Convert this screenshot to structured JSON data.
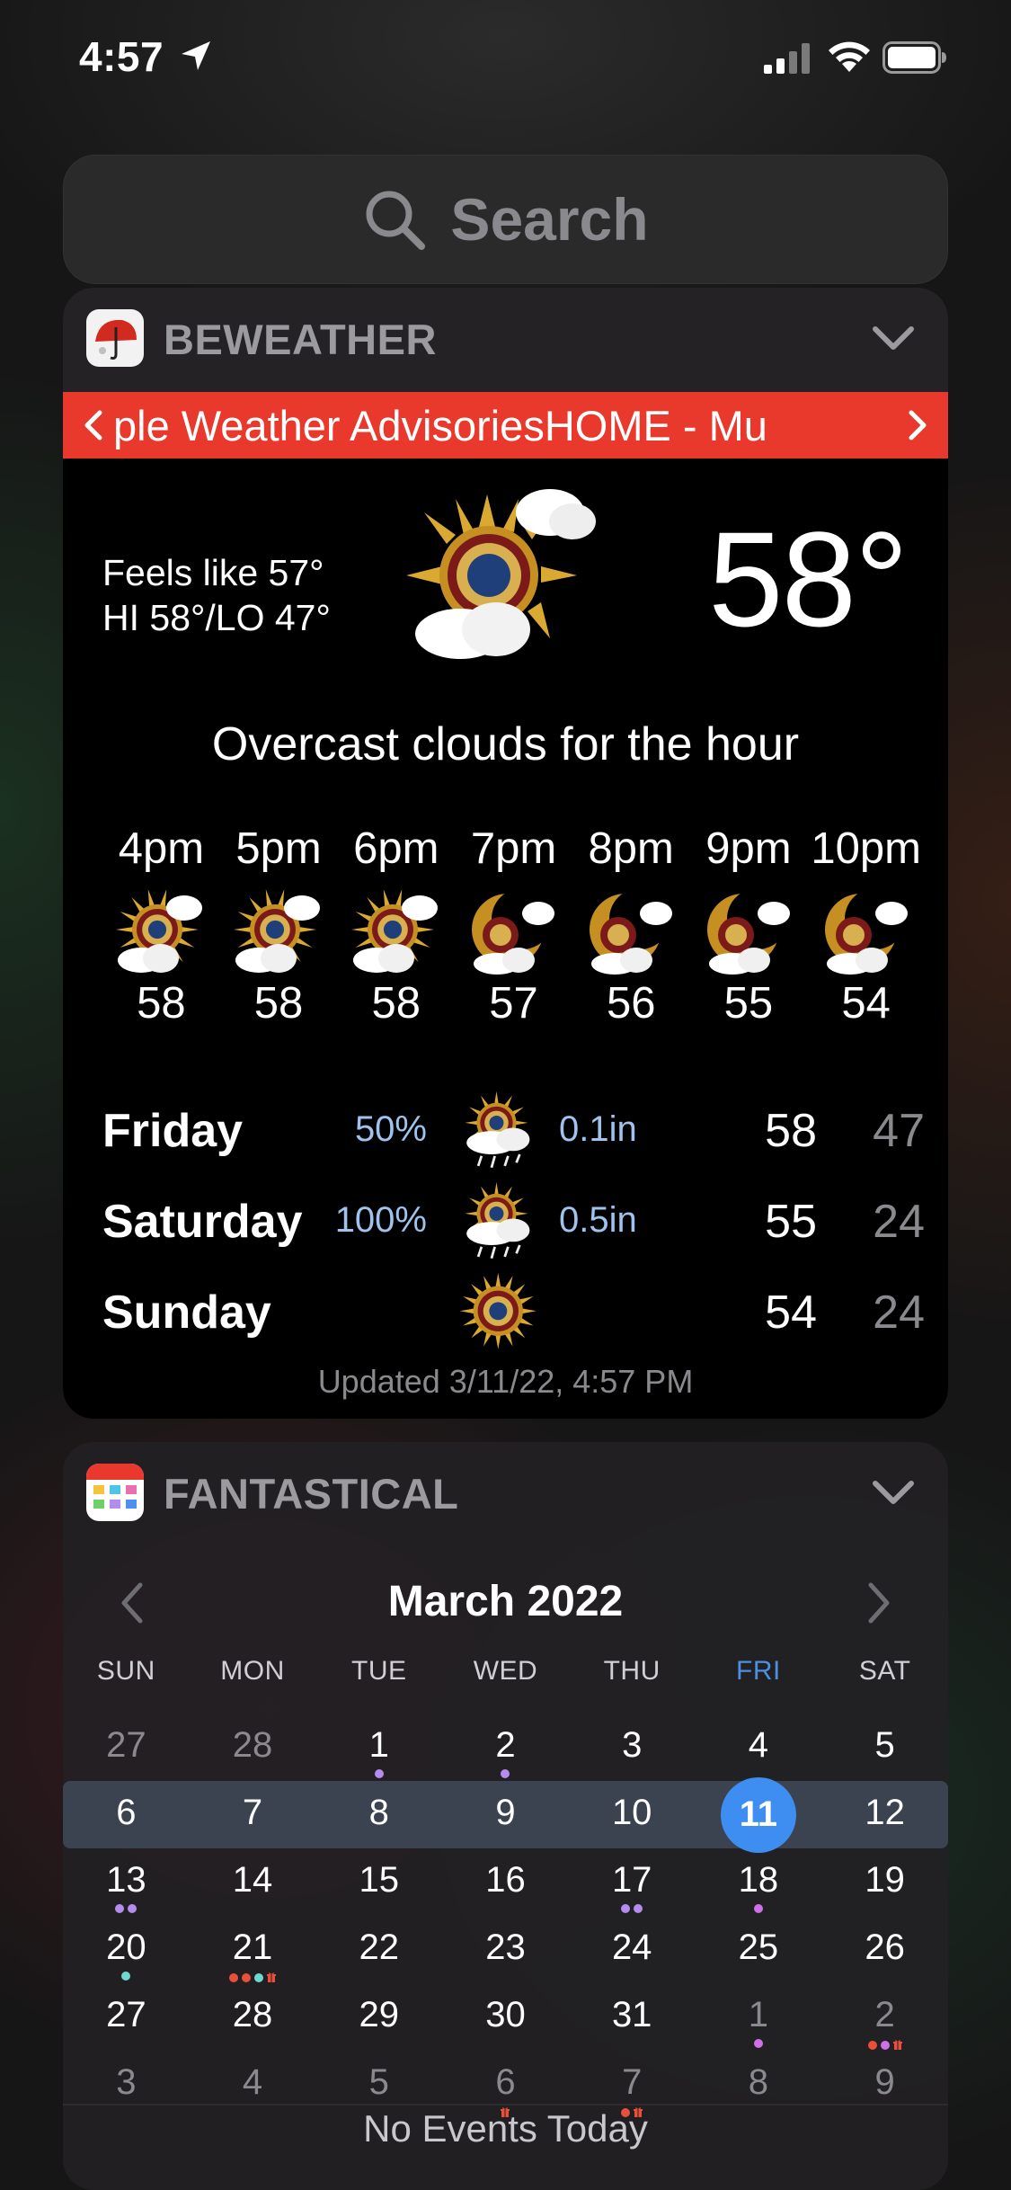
{
  "status_bar": {
    "time": "4:57"
  },
  "search": {
    "placeholder": "Search"
  },
  "beweather": {
    "title": "BEWEATHER",
    "ticker": "ple Weather AdvisoriesHOME - Mu",
    "feels_like": "Feels like 57°",
    "hi_lo": "HI 58°/LO 47°",
    "temperature": "58°",
    "summary": "Overcast clouds for the hour",
    "hourly": [
      {
        "time": "4pm",
        "temp": "58",
        "icon": "sun-cloud-emblem-icon"
      },
      {
        "time": "5pm",
        "temp": "58",
        "icon": "sun-cloud-emblem-icon"
      },
      {
        "time": "6pm",
        "temp": "58",
        "icon": "sun-cloud-emblem-icon"
      },
      {
        "time": "7pm",
        "temp": "57",
        "icon": "moon-cloud-emblem-icon"
      },
      {
        "time": "8pm",
        "temp": "56",
        "icon": "moon-cloud-emblem-icon"
      },
      {
        "time": "9pm",
        "temp": "55",
        "icon": "moon-cloud-emblem-icon"
      },
      {
        "time": "10pm",
        "temp": "54",
        "icon": "moon-cloud-emblem-icon"
      }
    ],
    "daily": [
      {
        "day": "Friday",
        "pop": "50%",
        "amount": "0.1in",
        "hi": "58",
        "lo": "47",
        "icon": "rain-emblem-icon"
      },
      {
        "day": "Saturday",
        "pop": "100%",
        "amount": "0.5in",
        "hi": "55",
        "lo": "24",
        "icon": "rain-emblem-icon"
      },
      {
        "day": "Sunday",
        "pop": "",
        "amount": "",
        "hi": "54",
        "lo": "24",
        "icon": "sun-emblem-icon"
      }
    ],
    "updated": "Updated 3/11/22, 4:57 PM",
    "colors": {
      "ticker": "#e8392c",
      "precip": "#9fc3ec"
    }
  },
  "fantastical": {
    "title": "FANTASTICAL",
    "month": "March 2022",
    "weekdays": [
      "SUN",
      "MON",
      "TUE",
      "WED",
      "THU",
      "FRI",
      "SAT"
    ],
    "today_weekday_index": 5,
    "weeks": [
      [
        {
          "d": "27",
          "o": true
        },
        {
          "d": "28",
          "o": true
        },
        {
          "d": "1",
          "dots": [
            "#b48cf0"
          ]
        },
        {
          "d": "2",
          "dots": [
            "#b48cf0"
          ]
        },
        {
          "d": "3"
        },
        {
          "d": "4"
        },
        {
          "d": "5"
        }
      ],
      [
        {
          "d": "6"
        },
        {
          "d": "7"
        },
        {
          "d": "8"
        },
        {
          "d": "9"
        },
        {
          "d": "10"
        },
        {
          "d": "11",
          "today": true
        },
        {
          "d": "12"
        }
      ],
      [
        {
          "d": "13",
          "dots": [
            "#b48cf0",
            "#b48cf0"
          ]
        },
        {
          "d": "14"
        },
        {
          "d": "15"
        },
        {
          "d": "16"
        },
        {
          "d": "17",
          "dots": [
            "#b48cf0",
            "#b48cf0"
          ]
        },
        {
          "d": "18",
          "dots": [
            "#d070e8"
          ]
        },
        {
          "d": "19"
        }
      ],
      [
        {
          "d": "20",
          "dots": [
            "#6fd8d0"
          ]
        },
        {
          "d": "21",
          "dots": [
            "#e8503a",
            "#e8503a",
            "#6fd8d0"
          ],
          "gift": true
        },
        {
          "d": "22"
        },
        {
          "d": "23"
        },
        {
          "d": "24"
        },
        {
          "d": "25"
        },
        {
          "d": "26"
        }
      ],
      [
        {
          "d": "27"
        },
        {
          "d": "28"
        },
        {
          "d": "29"
        },
        {
          "d": "30"
        },
        {
          "d": "31"
        },
        {
          "d": "1",
          "o": true,
          "dots": [
            "#d070e8"
          ]
        },
        {
          "d": "2",
          "o": true,
          "dots": [
            "#e8503a",
            "#d070e8"
          ],
          "gift": true
        }
      ],
      [
        {
          "d": "3",
          "o": true
        },
        {
          "d": "4",
          "o": true
        },
        {
          "d": "5",
          "o": true
        },
        {
          "d": "6",
          "o": true,
          "gift": true
        },
        {
          "d": "7",
          "o": true,
          "dots": [
            "#e8503a"
          ],
          "gift": true
        },
        {
          "d": "8",
          "o": true
        },
        {
          "d": "9",
          "o": true
        }
      ]
    ],
    "no_events": "No Events Today",
    "colors": {
      "today": "#3d8ef0",
      "current_week": "#3b4350",
      "today_weekday": "#4d8fe0"
    }
  }
}
